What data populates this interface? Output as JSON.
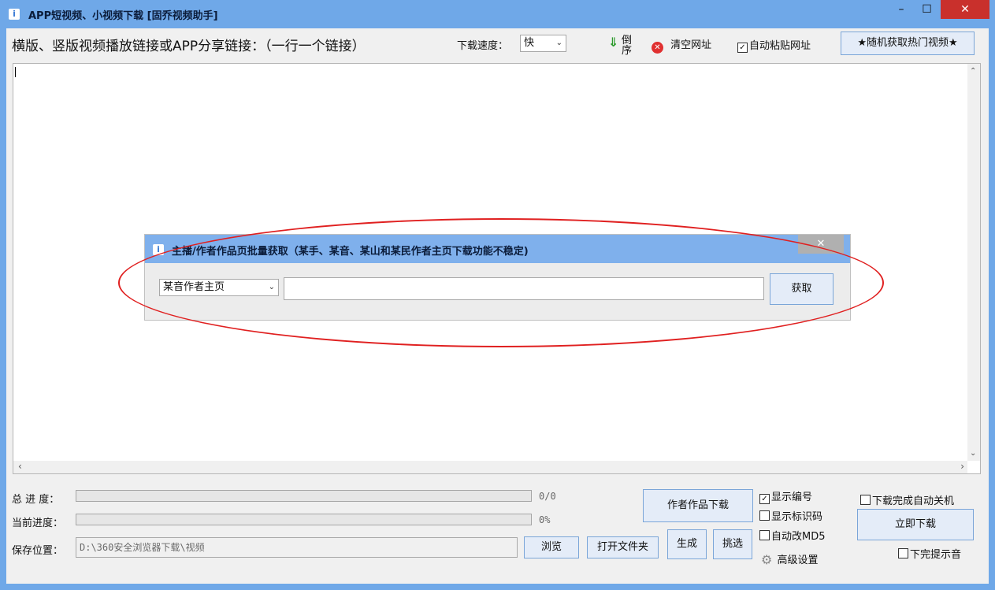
{
  "window": {
    "title": "APP短视频、小视频下载 [固乔视频助手]",
    "minimize": "–",
    "maximize": "☐",
    "close": "✕"
  },
  "toolbar": {
    "link_label": "横版、竖版视频播放链接或APP分享链接：（一行一个链接）",
    "speed_label": "下载速度：",
    "speed_value": "快",
    "reverse_label_1": "倒",
    "reverse_label_2": "序",
    "clear_label": "清空网址",
    "auto_paste_label": "自动粘贴网址",
    "auto_paste_checked": true,
    "random_hot_label": "★随机获取热门视频★"
  },
  "dialog": {
    "title": "主播/作者作品页批量获取（某手、某音、某山和某民作者主页下载功能不稳定)",
    "close": "✕",
    "source_value": "某音作者主页",
    "url_value": "",
    "fetch_label": "获取"
  },
  "bottom": {
    "total_progress_label": "总 进 度：",
    "total_progress_text": "0/0",
    "total_progress": 0,
    "current_progress_label": "当前进度：",
    "current_progress_text": "0%",
    "current_progress": 0,
    "save_label": "保存位置：",
    "save_path": "D:\\360安全浏览器下载\\视频",
    "browse_label": "浏览",
    "open_folder_label": "打开文件夹",
    "author_download_label": "作者作品下载",
    "generate_label": "生成",
    "pick_label": "挑选",
    "show_number_label": "显示编号",
    "show_number_checked": true,
    "show_id_label": "显示标识码",
    "show_id_checked": false,
    "auto_md5_label": "自动改MD5",
    "auto_md5_checked": false,
    "advanced_label": "高级设置",
    "auto_shutdown_label": "下载完成自动关机",
    "auto_shutdown_checked": false,
    "download_now_label": "立即下载",
    "finish_sound_label": "下完提示音",
    "finish_sound_checked": false
  },
  "colors": {
    "titlebar": "#6fa8e8",
    "dialog_titlebar": "#7fb0ec",
    "close_button": "#c9302c",
    "annotation": "#e02020"
  }
}
